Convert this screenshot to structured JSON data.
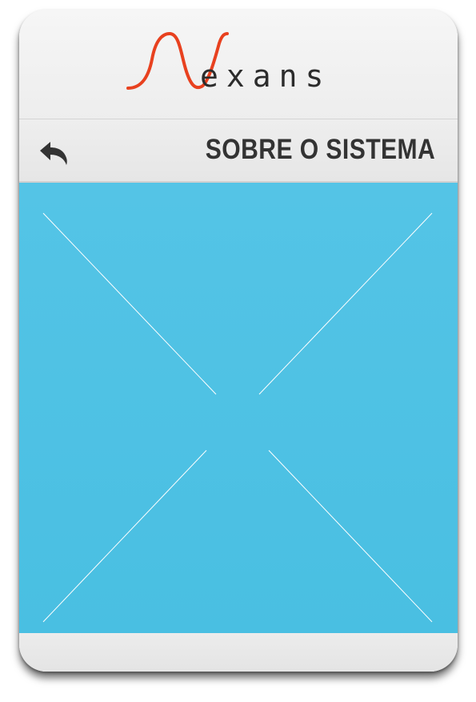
{
  "brand": {
    "wordmark": "exans",
    "logo_icon": "nexans-wave-n-logo",
    "logo_color": "#e8411f",
    "wordmark_color": "#2c2c2c"
  },
  "header": {
    "back_icon": "back-arrow-icon",
    "title": "SOBRE O SISTEMA",
    "title_color": "#333333"
  },
  "content": {
    "placeholder_icon": "image-placeholder-x",
    "background_color": "#4ec2e4",
    "line_color": "#ffffff"
  }
}
